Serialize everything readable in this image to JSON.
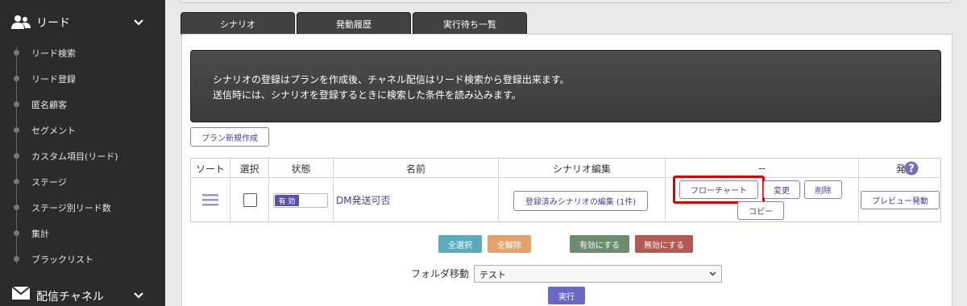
{
  "sidebar": {
    "section1": {
      "title": "リード"
    },
    "items": [
      {
        "label": "リード検索"
      },
      {
        "label": "リード登録"
      },
      {
        "label": "匿名顧客"
      },
      {
        "label": "セグメント"
      },
      {
        "label": "カスタム項目(リード)"
      },
      {
        "label": "ステージ"
      },
      {
        "label": "ステージ別リード数"
      },
      {
        "label": "集計"
      },
      {
        "label": "ブラックリスト"
      }
    ],
    "section2": {
      "title": "配信チャネル"
    }
  },
  "tabs": [
    {
      "label": "シナリオ"
    },
    {
      "label": "発動履歴"
    },
    {
      "label": "実行待ち一覧"
    }
  ],
  "notice": {
    "line1": "シナリオの登録はプランを作成後、チャネル配信はリード検索から登録出来ます。",
    "line2": "送信時には、シナリオを登録するときに検索した条件を読み込みます。"
  },
  "new_plan_label": "プラン新規作成",
  "table": {
    "headers": {
      "sort": "ソート",
      "select": "選択",
      "status": "状態",
      "name": "名前",
      "scenario_edit": "シナリオ編集",
      "actions": "--",
      "trigger": "発動"
    },
    "row": {
      "status_on": "有 効",
      "name": "DM発送可否",
      "scenario_edit_btn": "登録済みシナリオの編集 (1件)",
      "flowchart_btn": "フローチャート",
      "change_btn": "変更",
      "delete_btn": "削除",
      "copy_btn": "コピー",
      "preview_btn": "プレビュー発動"
    }
  },
  "bulk": {
    "select_all": "全選択",
    "deselect_all": "全解除",
    "enable": "有効にする",
    "disable": "無効にする"
  },
  "folder": {
    "label": "フォルダ移動",
    "selected": "テスト",
    "run": "実行"
  },
  "colors": {
    "sidebar_bg": "#2b2b2b",
    "accent": "#4a3d8f",
    "highlight": "#e00000",
    "select_all": "#5aacbc",
    "deselect_all": "#e4a36c",
    "enable": "#6e8c6e",
    "disable": "#b35a55",
    "run": "#6b68c3"
  }
}
